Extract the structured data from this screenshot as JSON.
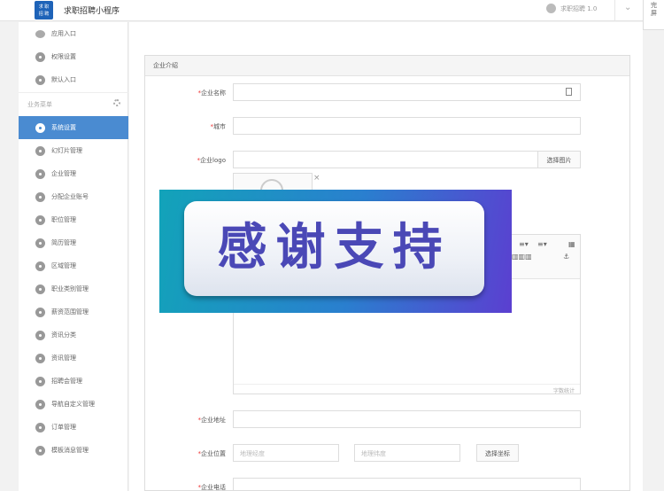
{
  "header": {
    "logo_text": "求职招聘",
    "app_title": "求职招聘小程序",
    "version": "求职招聘 1.0",
    "side_tab": "完\n屏"
  },
  "sidebar": {
    "top_items": [
      {
        "label": "应用入口",
        "icon": "chat-bubble-icon"
      },
      {
        "label": "权限设置",
        "icon": "gear-icon"
      },
      {
        "label": "默认入口",
        "icon": "gear-icon"
      }
    ],
    "section_label": "业务菜单",
    "menu_items": [
      {
        "label": "系统设置",
        "active": true
      },
      {
        "label": "幻灯片管理"
      },
      {
        "label": "企业管理"
      },
      {
        "label": "分配企业账号"
      },
      {
        "label": "职位管理"
      },
      {
        "label": "简历管理"
      },
      {
        "label": "区域管理"
      },
      {
        "label": "职业类别管理"
      },
      {
        "label": "薪资范围管理"
      },
      {
        "label": "资讯分类"
      },
      {
        "label": "资讯管理"
      },
      {
        "label": "招聘会管理"
      },
      {
        "label": "导航自定义管理"
      },
      {
        "label": "订单管理"
      },
      {
        "label": "模板消息管理"
      }
    ]
  },
  "form": {
    "panel_title": "企业介绍",
    "name_label": "企业名称",
    "city_label": "城市",
    "logo_label": "企业logo",
    "choose_image": "选择图片",
    "address_label": "企业地址",
    "location_label": "企业位置",
    "lng_placeholder": "地理经度",
    "lat_placeholder": "地理纬度",
    "choose_coord": "选择坐标",
    "phone_label": "企业电话",
    "word_count": "字数统计"
  },
  "banner": {
    "text": "感谢支持"
  },
  "colors": {
    "accent": "#4a8bd1",
    "required": "#ee3333",
    "banner_text": "#4a48b6"
  }
}
